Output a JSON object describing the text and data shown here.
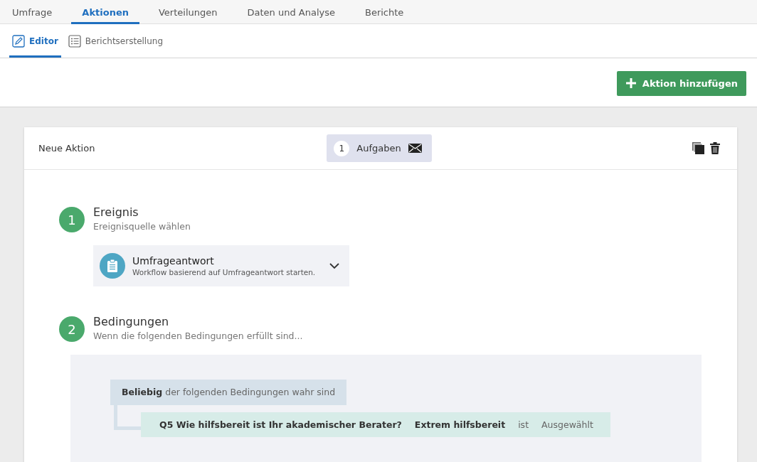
{
  "main_tabs": [
    {
      "label": "Umfrage",
      "selected": false
    },
    {
      "label": "Aktionen",
      "selected": true
    },
    {
      "label": "Verteilungen",
      "selected": false
    },
    {
      "label": "Daten und Analyse",
      "selected": false
    },
    {
      "label": "Berichte",
      "selected": false
    }
  ],
  "sub_tabs": [
    {
      "label": "Editor",
      "kind": "edit",
      "selected": true
    },
    {
      "label": "Berichtserstellung",
      "kind": "list",
      "selected": false
    }
  ],
  "add_button": "Aktion hinzufügen",
  "action": {
    "title": "Neue Aktion",
    "task_count": "1",
    "task_label": "Aufgaben",
    "steps": [
      {
        "number": "1",
        "title": "Ereignis",
        "subtitle": "Ereignisquelle wählen",
        "kind": "event",
        "event": {
          "title": "Umfrageantwort",
          "description": "Workflow basierend auf Umfrageantwort starten."
        }
      },
      {
        "number": "2",
        "title": "Bedingungen",
        "subtitle": "Wenn die folgenden Bedingungen erfüllt sind...",
        "kind": "conditions",
        "group": {
          "label": "**Beliebig** der folgenden Bedingungen wahr sind",
          "conditions": [
            {
              "question": "Q5 Wie hilfsbereit ist Ihr akademischer Berater?",
              "choice": "Extrem hilfsbereit",
              "operator": "ist",
              "value": "Ausgewählt"
            }
          ]
        }
      }
    ]
  }
}
